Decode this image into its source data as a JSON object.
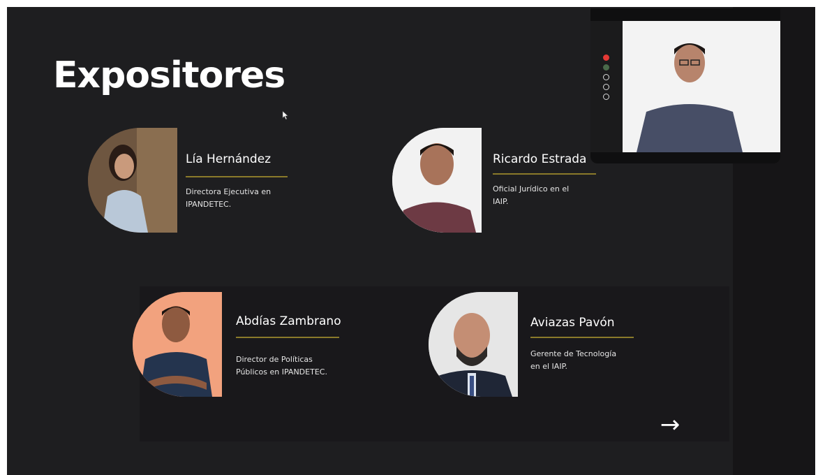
{
  "slide": {
    "title": "Expositores"
  },
  "speakers": [
    {
      "name": "Lía Hernández",
      "role_line1": "Directora Ejecutiva en",
      "role_line2": "IPANDETEC."
    },
    {
      "name": "Ricardo Estrada",
      "role_line1": "Oficial Jurídico en el",
      "role_line2": "IAIP."
    },
    {
      "name": "Abdías Zambrano",
      "role_line1": "Director de Políticas",
      "role_line2": "Públicos en IPANDETEC."
    },
    {
      "name": "Aviazas Pavón",
      "role_line1": "Gerente de Tecnología",
      "role_line2": "en el IAIP."
    }
  ],
  "navigation": {
    "next_label": "→"
  },
  "video_call": {
    "icons": [
      "record-icon",
      "person-icon",
      "refresh-icon",
      "circle-icon",
      "circle-icon"
    ]
  },
  "colors": {
    "background": "#1e1e20",
    "accent_rule": "#8a7a2a",
    "text": "#ffffff"
  }
}
